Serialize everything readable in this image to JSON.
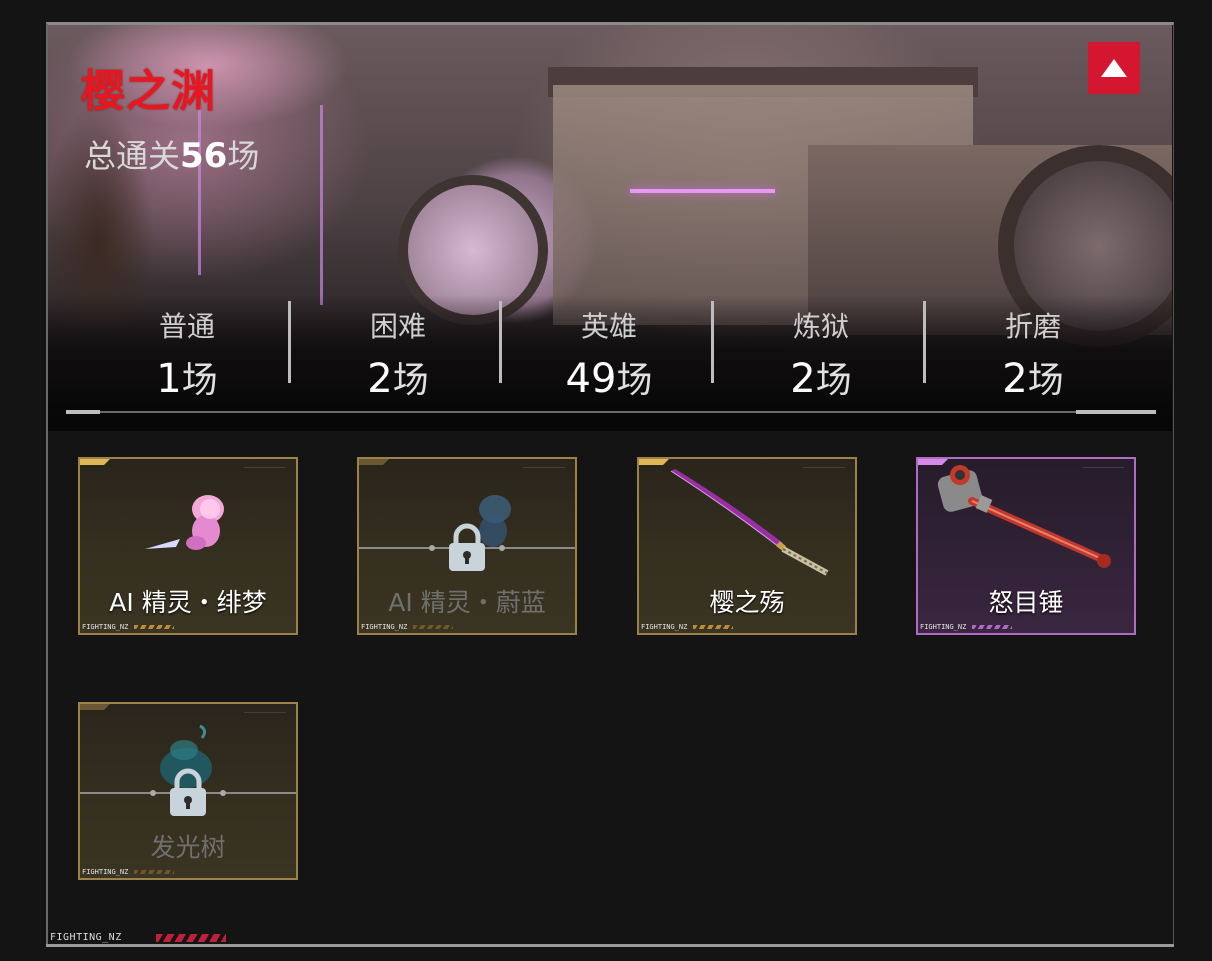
{
  "banner": {
    "title": "樱之渊",
    "total_prefix": "总通关",
    "total_count": "56",
    "total_suffix": "场",
    "collapse_icon": "triangle-up-icon",
    "accent": "#d51630"
  },
  "difficulties": [
    {
      "label": "普通",
      "count": "1",
      "unit": "场"
    },
    {
      "label": "困难",
      "count": "2",
      "unit": "场"
    },
    {
      "label": "英雄",
      "count": "49",
      "unit": "场"
    },
    {
      "label": "炼狱",
      "count": "2",
      "unit": "场"
    },
    {
      "label": "折磨",
      "count": "2",
      "unit": "场"
    }
  ],
  "rewards": [
    {
      "name": "AI 精灵・绯梦",
      "tag": "FIGHTING_NZ",
      "locked": false,
      "rarity": "gold",
      "icon": "pink-spirit-icon"
    },
    {
      "name": "AI 精灵・蔚蓝",
      "tag": "FIGHTING_NZ",
      "locked": true,
      "rarity": "gold",
      "icon": "blue-spirit-icon"
    },
    {
      "name": "樱之殇",
      "tag": "FIGHTING_NZ",
      "locked": false,
      "rarity": "gold",
      "icon": "katana-icon"
    },
    {
      "name": "怒目锤",
      "tag": "FIGHTING_NZ",
      "locked": false,
      "rarity": "purple",
      "icon": "hammer-icon"
    },
    {
      "name": "发光树",
      "tag": "FIGHTING_NZ",
      "locked": true,
      "rarity": "gold",
      "icon": "glowing-tree-icon"
    }
  ],
  "footer": {
    "tag": "FIGHTING_NZ"
  }
}
